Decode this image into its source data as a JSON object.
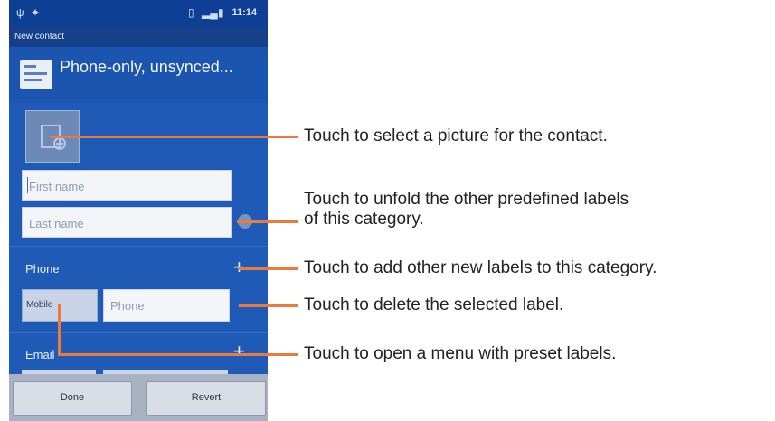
{
  "status_bar": {
    "time": "11:14"
  },
  "title_bar": {
    "title": "New contact"
  },
  "account": {
    "label": "Phone-only, unsynced..."
  },
  "form": {
    "first_name_placeholder": "First name",
    "last_name_placeholder": "Last name",
    "phone_section_label": "Phone",
    "mobile_label_button": "Mobile",
    "phone_placeholder": "Phone",
    "email_section_label": "Email"
  },
  "bottom_bar": {
    "done_label": "Done",
    "revert_label": "Revert"
  },
  "callouts": [
    {
      "text": "Touch to select a picture for the contact."
    },
    {
      "text": "Touch to unfold the other predefined labels"
    },
    {
      "text": "of this category."
    },
    {
      "text": "Touch to add other new labels to this category."
    },
    {
      "text": "Touch to delete the selected label."
    },
    {
      "text": "Touch to open a menu with preset labels."
    }
  ],
  "colors": {
    "accent": "#ec7a3c",
    "screen_bg": "#1f5ab6"
  }
}
